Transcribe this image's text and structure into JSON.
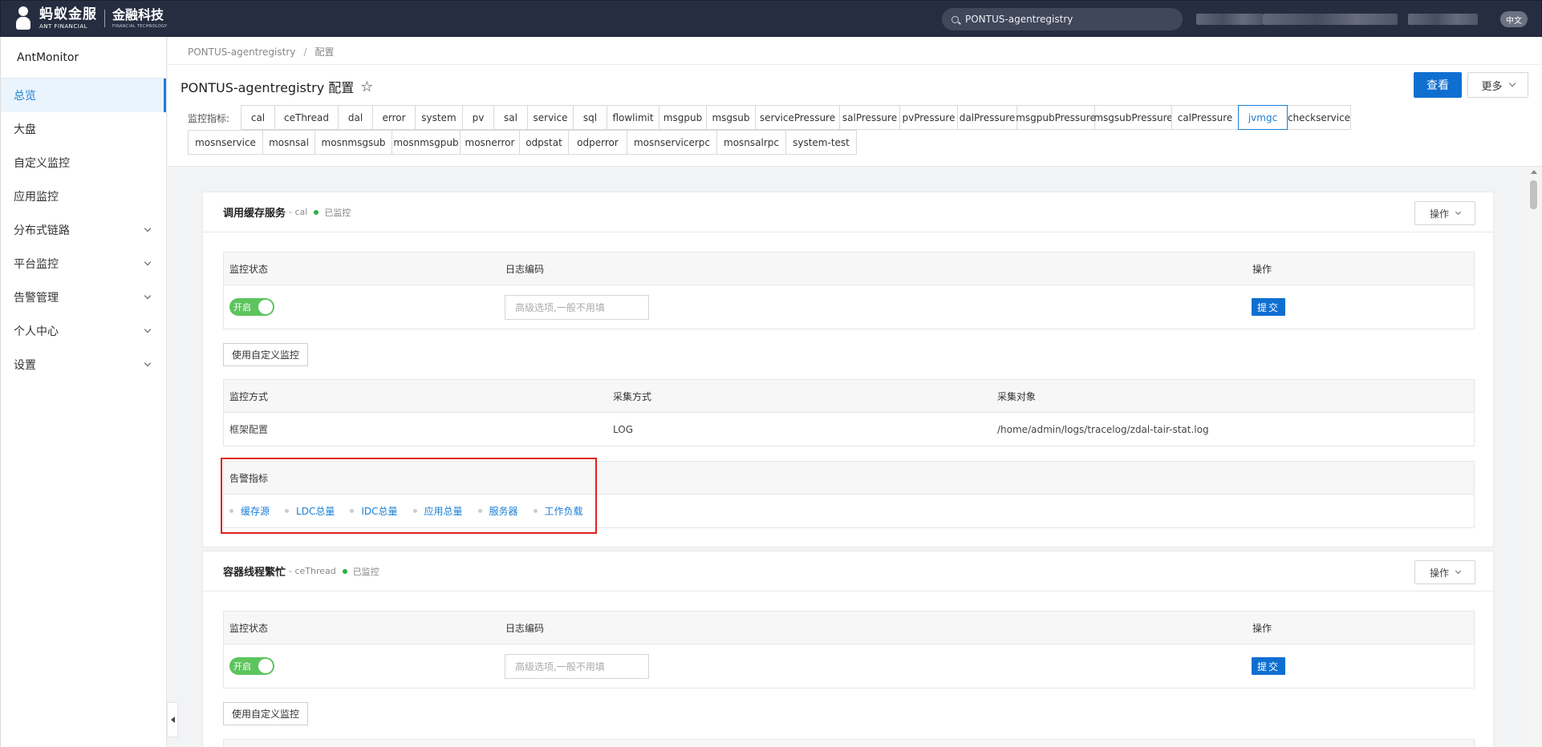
{
  "topbar": {
    "logo_cn": "蚂蚁金服",
    "logo_en": "ANT FINANCIAL",
    "logo_sub_cn": "金融科技",
    "logo_sub_en": "FINANCIAL TECHNOLOGY",
    "search_value": "PONTUS-agentregistry",
    "lang": "中文"
  },
  "sidebar": {
    "title": "AntMonitor",
    "items": [
      {
        "label": "总览",
        "active": true,
        "chevron": false
      },
      {
        "label": "大盘",
        "active": false,
        "chevron": false
      },
      {
        "label": "自定义监控",
        "active": false,
        "chevron": false
      },
      {
        "label": "应用监控",
        "active": false,
        "chevron": false
      },
      {
        "label": "分布式链路",
        "active": false,
        "chevron": true
      },
      {
        "label": "平台监控",
        "active": false,
        "chevron": true
      },
      {
        "label": "告警管理",
        "active": false,
        "chevron": true
      },
      {
        "label": "个人中心",
        "active": false,
        "chevron": true
      },
      {
        "label": "设置",
        "active": false,
        "chevron": true
      }
    ]
  },
  "breadcrumb": {
    "app": "PONTUS-agentregistry",
    "sep": "/",
    "current": "配置"
  },
  "page": {
    "title": "PONTUS-agentregistry 配置",
    "view_label": "查看",
    "more_label": "更多"
  },
  "metrics": {
    "label": "监控指标:",
    "selected": "jvmgc",
    "row1": [
      "cal",
      "ceThread",
      "dal",
      "error",
      "system",
      "pv",
      "sal",
      "service",
      "sql",
      "flowlimit",
      "msgpub",
      "msgsub",
      "servicePressure",
      "salPressure",
      "pvPressure",
      "dalPressure",
      "msgpubPressure",
      "msgsubPressure",
      "calPressure",
      "jvmgc",
      "checkservice"
    ],
    "row2": [
      "mosnservice",
      "mosnsal",
      "mosnmsgsub",
      "mosnmsgpub",
      "mosnerror",
      "odpstat",
      "odperror",
      "mosnservicerpc",
      "mosnsalrpc",
      "system-test"
    ]
  },
  "cards": [
    {
      "title": "调用缓存服务",
      "sub": "- cal",
      "state": "已监控",
      "op_label": "操作",
      "status_table": {
        "h_status": "监控状态",
        "h_code": "日志编码",
        "h_op": "操作",
        "toggle": "开启",
        "placeholder": "高级选项,一般不用填",
        "submit": "提交"
      },
      "custom_btn": "使用自定义监控",
      "method_table": {
        "h_method": "监控方式",
        "h_collect": "采集方式",
        "h_target": "采集对象",
        "method": "框架配置",
        "collect": "LOG",
        "target": "/home/admin/logs/tracelog/zdal-tair-stat.log"
      },
      "alarm": {
        "header": "告警指标",
        "links": [
          "缓存源",
          "LDC总量",
          "IDC总量",
          "应用总量",
          "服务器",
          "工作负载"
        ]
      }
    },
    {
      "title": "容器线程繁忙",
      "sub": "- ceThread",
      "state": "已监控",
      "op_label": "操作",
      "status_table": {
        "h_status": "监控状态",
        "h_code": "日志编码",
        "h_op": "操作",
        "toggle": "开启",
        "placeholder": "高级选项,一般不用填",
        "submit": "提交"
      },
      "custom_btn": "使用自定义监控"
    }
  ]
}
